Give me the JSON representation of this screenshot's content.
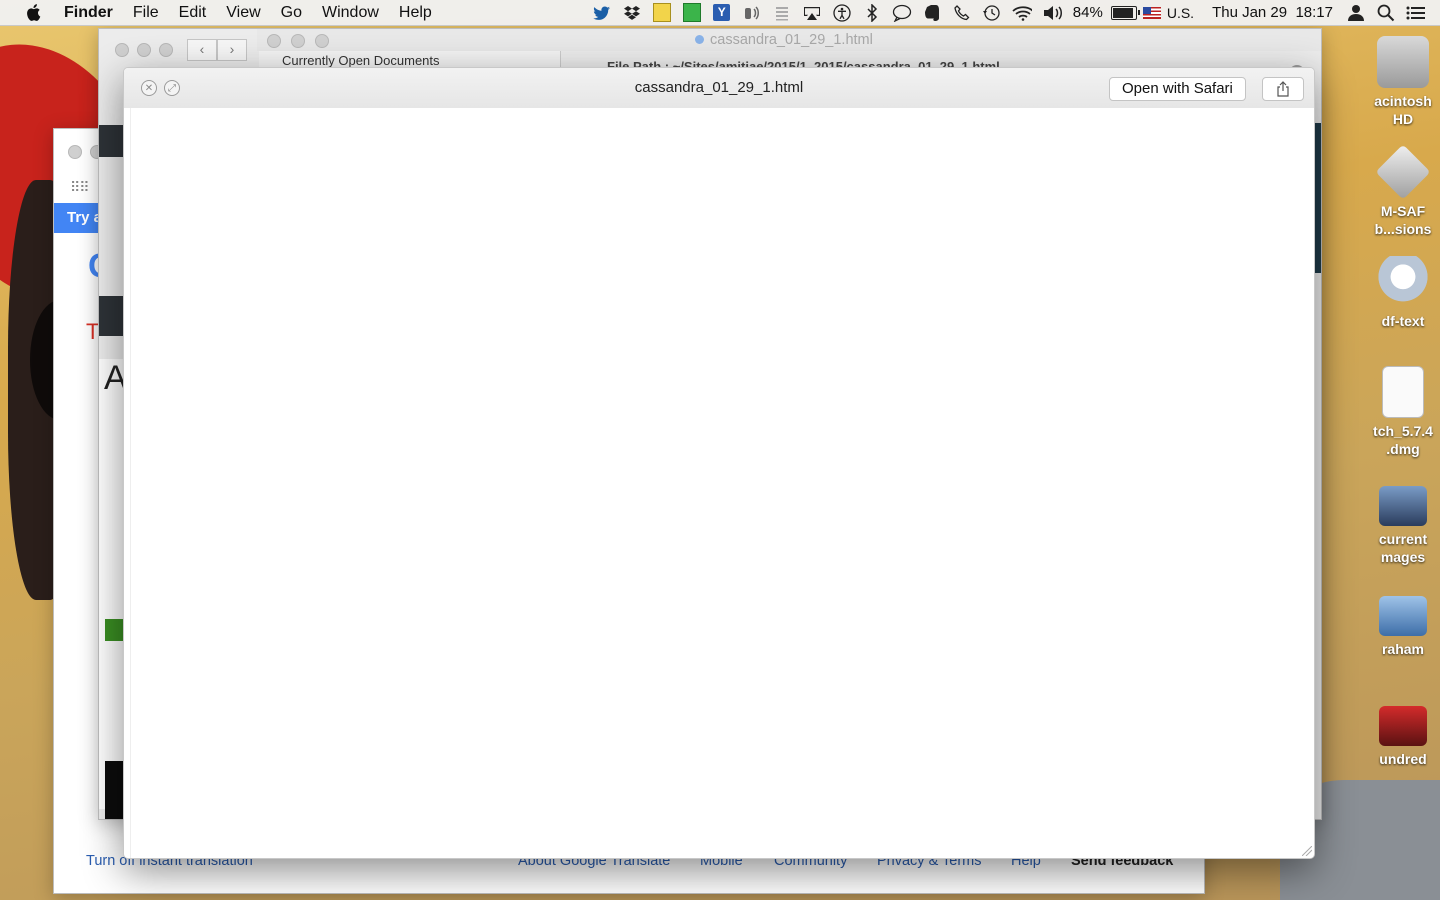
{
  "menubar": {
    "app_name": "Finder",
    "menus": [
      "File",
      "Edit",
      "View",
      "Go",
      "Window",
      "Help"
    ],
    "battery_percent": "84%",
    "input_source": "U.S.",
    "clock": "Thu Jan 29  18:17"
  },
  "quicklook": {
    "title": "cassandra_01_29_1.html",
    "open_button": "Open with Safari"
  },
  "background_window": {
    "title": "cassandra_01_29_1.html",
    "sidebar_header": "Currently Open Documents",
    "file_path": "File Path : ~/Sites/amitiae/2015/1_2015/cassandra_01_29_1.html"
  },
  "translate_window": {
    "try_label": "Try a",
    "footer": {
      "turn_off": "Turn off instant translation",
      "about": "About Google Translate",
      "mobile": "Mobile",
      "community": "Community",
      "privacy": "Privacy & Terms",
      "help": "Help",
      "feedback": "Send feedback"
    }
  },
  "desktop_icons": [
    {
      "label": "acintosh HD"
    },
    {
      "label": "M-SAF b...sions"
    },
    {
      "label": "df-text"
    },
    {
      "label": "tch_5.7.4 .dmg"
    },
    {
      "label": "current mages"
    },
    {
      "label": "raham"
    },
    {
      "label": "undred"
    }
  ]
}
